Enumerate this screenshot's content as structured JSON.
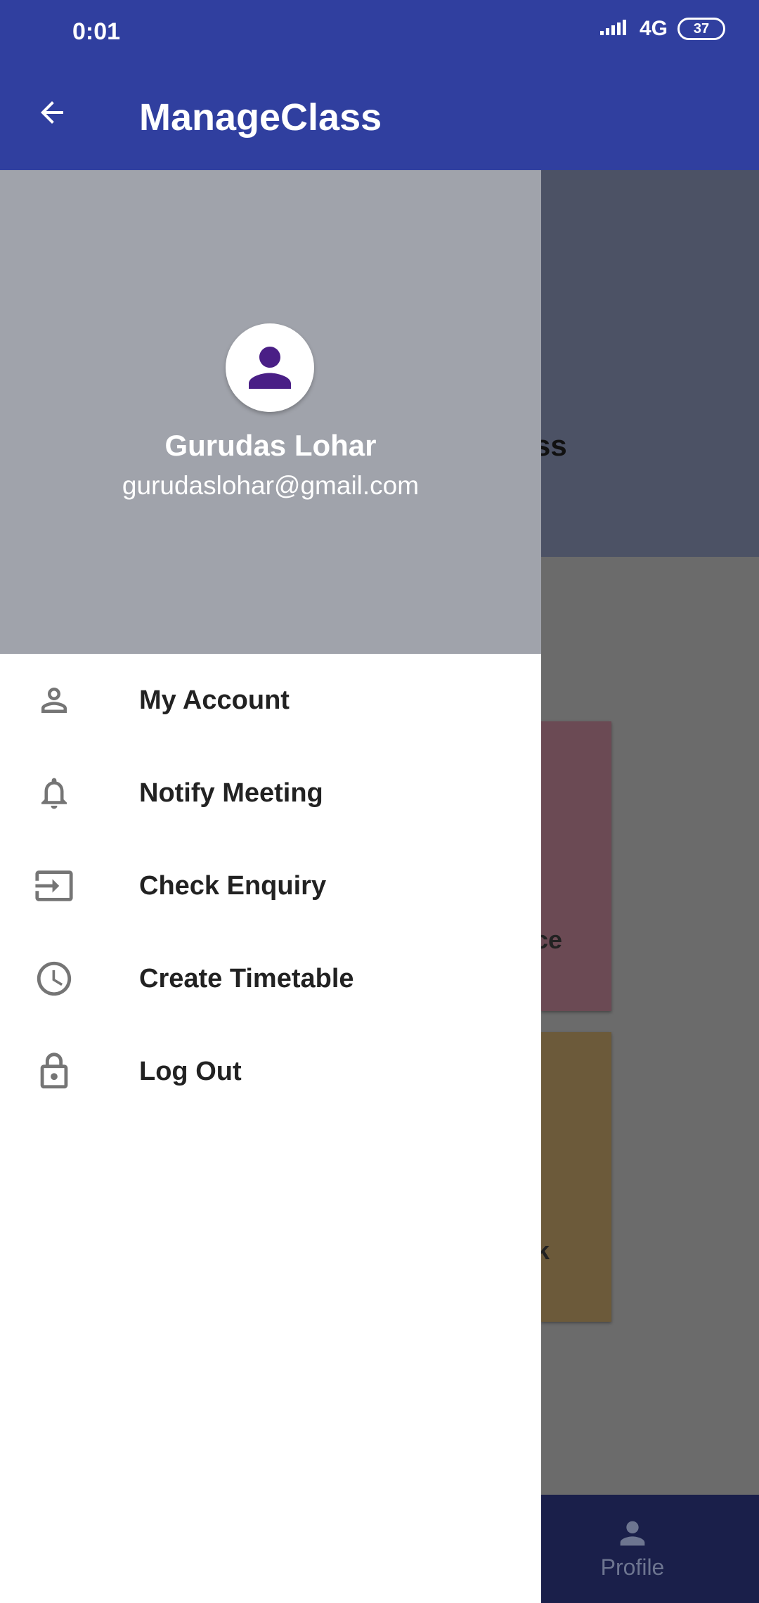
{
  "status_bar": {
    "time": "0:01",
    "network": "4G",
    "battery": "37"
  },
  "app_bar": {
    "title": "ManageClass"
  },
  "background": {
    "header_text": "ss",
    "card_red_text": "ce",
    "card_yellow_text": "k",
    "bottom_nav": {
      "profile_label": "Profile"
    }
  },
  "drawer": {
    "user": {
      "name": "Gurudas Lohar",
      "email": "gurudaslohar@gmail.com"
    },
    "items": [
      {
        "label": "My Account",
        "icon": "person-icon"
      },
      {
        "label": "Notify Meeting",
        "icon": "bell-icon"
      },
      {
        "label": "Check Enquiry",
        "icon": "input-icon"
      },
      {
        "label": "Create Timetable",
        "icon": "clock-icon"
      },
      {
        "label": "Log Out",
        "icon": "lock-icon"
      }
    ]
  },
  "colors": {
    "primary": "#303f9f",
    "avatar_icon": "#4a1f86",
    "drawer_header": "#a0a3ab"
  }
}
